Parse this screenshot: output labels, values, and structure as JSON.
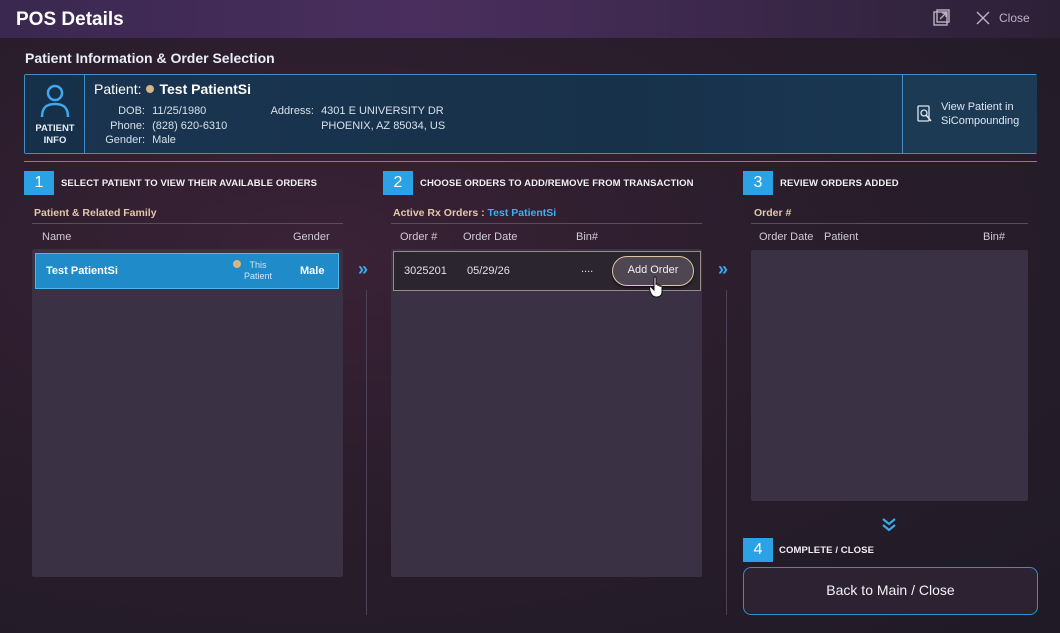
{
  "window": {
    "title": "POS Details",
    "close_label": "Close"
  },
  "section_title": "Patient Information & Order Selection",
  "patient_card": {
    "info_label_1": "PATIENT",
    "info_label_2": "INFO",
    "patient_label": "Patient:",
    "patient_name": "Test PatientSi",
    "dob_key": "DOB:",
    "dob": "11/25/1980",
    "phone_key": "Phone:",
    "phone": "(828) 620-6310",
    "gender_key": "Gender:",
    "gender": "Male",
    "address_key": "Address:",
    "address_line1": "4301 E UNIVERSITY DR",
    "address_line2": "PHOENIX, AZ 85034, US",
    "view_line1": "View Patient in",
    "view_line2": "SiCompounding"
  },
  "step1": {
    "num": "1",
    "label": "SELECT PATIENT TO VIEW THEIR AVAILABLE ORDERS",
    "sub_head": "Patient & Related Family",
    "col_name": "Name",
    "col_gender": "Gender",
    "row": {
      "name": "Test PatientSi",
      "tag_1": "This",
      "tag_2": "Patient",
      "gender": "Male"
    }
  },
  "step2": {
    "num": "2",
    "label": "CHOOSE ORDERS TO ADD/REMOVE FROM TRANSACTION",
    "sub_head": "Active Rx Orders :",
    "sub_head_name": "Test PatientSi",
    "col_order": "Order #",
    "col_date": "Order Date",
    "col_bin": "Bin#",
    "row": {
      "order": "3025201",
      "date": "05/29/26",
      "bin": "....",
      "action": "Add Order"
    }
  },
  "step3": {
    "num": "3",
    "label": "REVIEW ORDERS ADDED",
    "sub_head": "Order #",
    "col_date": "Order Date",
    "col_patient": "Patient",
    "col_bin": "Bin#"
  },
  "step4": {
    "num": "4",
    "label": "COMPLETE / CLOSE",
    "button": "Back to Main / Close"
  },
  "colors": {
    "accent": "#2aa3e6",
    "selected_row": "#1f8bc8",
    "highlight": "#e2c8a8"
  },
  "icons": [
    "popout-icon",
    "close-icon",
    "patient-icon",
    "search-patient-icon",
    "double-chevron-right-icon",
    "double-chevron-down-icon",
    "hand-cursor-icon"
  ]
}
